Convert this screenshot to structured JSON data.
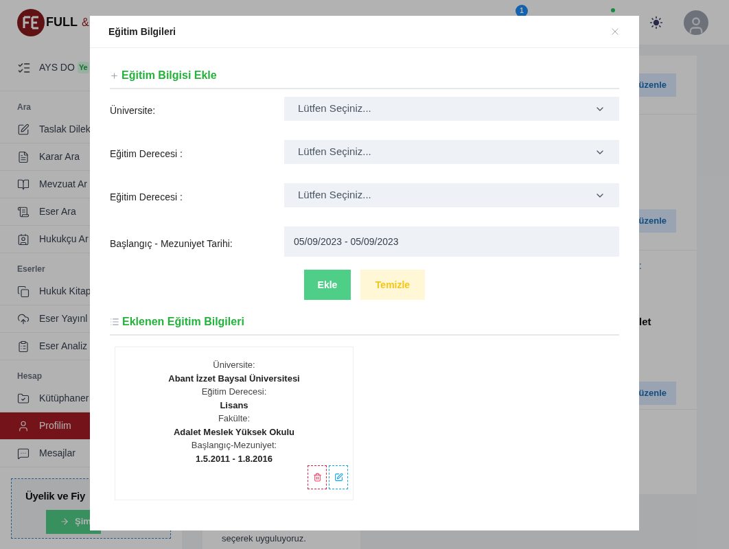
{
  "header": {
    "logo_text": "FULL",
    "logo_amp": "&",
    "notification_count": "1"
  },
  "sidebar": {
    "top_item": {
      "label": "AYS DO",
      "badge": "Ye"
    },
    "sections": [
      {
        "title": "Ara",
        "items": [
          {
            "label": "Taslak Dilek",
            "selected": false
          },
          {
            "label": "Karar Ara",
            "selected": false
          },
          {
            "label": "Mevzuat Ar",
            "selected": false
          },
          {
            "label": "Eser Ara",
            "selected": false
          },
          {
            "label": "Hukukçu Ar",
            "selected": false
          }
        ]
      },
      {
        "title": "Eserler",
        "items": [
          {
            "label": "Hukuk Kitap",
            "selected": false
          },
          {
            "label": "Eser Yayınl",
            "selected": false
          },
          {
            "label": "Eser Analiz",
            "selected": false
          }
        ]
      },
      {
        "title": "Hesap",
        "items": [
          {
            "label": "Kütüphaner",
            "selected": false
          },
          {
            "label": "Profilim",
            "selected": true
          },
          {
            "label": "Mesajlar",
            "selected": false
          }
        ]
      }
    ],
    "promo": {
      "title": "Üyelik ve Fiy",
      "button": "Şim"
    }
  },
  "background": {
    "edit_buttons": [
      "üzenle",
      "üzenle",
      "üzenle"
    ],
    "fragments": [
      ":",
      "let"
    ],
    "text_lines": [
      "seçerek uyguluyoruz."
    ]
  },
  "modal": {
    "title": "Eğitim Bilgileri",
    "form_title": "Eğitim Bilgisi Ekle",
    "fields": [
      {
        "kind": "select",
        "label": "Üniversite:",
        "placeholder": "Lütfen Seçiniz..."
      },
      {
        "kind": "select",
        "label": "Eğitim Derecesi :",
        "placeholder": "Lütfen Seçiniz..."
      },
      {
        "kind": "select",
        "label": "Eğitim Derecesi :",
        "placeholder": "Lütfen Seçiniz..."
      },
      {
        "kind": "date",
        "label": "Başlangıç - Mezuniyet Tarihi:",
        "value": "05/09/2023 - 05/09/2023"
      }
    ],
    "buttons": [
      {
        "kind": "primary",
        "label": "Ekle"
      },
      {
        "kind": "warning",
        "label": "Temizle"
      }
    ],
    "list_title": "Eklenen Eğitim Bilgileri",
    "entries": [
      {
        "rows": [
          {
            "label": "Üniversite:",
            "value": "Abant İzzet Baysal Üniversitesi"
          },
          {
            "label": "Eğitim Derecesi:",
            "value": "Lisans"
          },
          {
            "label": "Fakülte:",
            "value": "Adalet Meslek Yüksek Okulu"
          },
          {
            "label": "Başlangıç-Mezuniyet:",
            "value": "1.5.2011 - 1.8.2016"
          }
        ]
      }
    ]
  }
}
